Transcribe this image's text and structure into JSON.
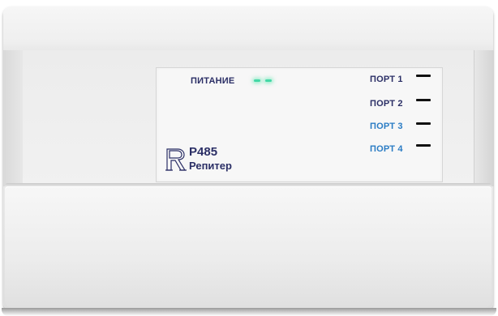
{
  "panel": {
    "power_label": "ПИТАНИЕ",
    "ports": [
      {
        "label": "ПОРТ 1",
        "color": "#2b2f66"
      },
      {
        "label": "ПОРТ 2",
        "color": "#2b2f66"
      },
      {
        "label": "ПОРТ 3",
        "color": "#2a7cc4"
      },
      {
        "label": "ПОРТ 4",
        "color": "#2a7cc4"
      }
    ],
    "brand": {
      "model": "P485",
      "subtitle": "Репитер",
      "logo": "R-logo-icon"
    },
    "led_color": "#43d8a6"
  },
  "device": {
    "body_color": "#eeeeee"
  }
}
